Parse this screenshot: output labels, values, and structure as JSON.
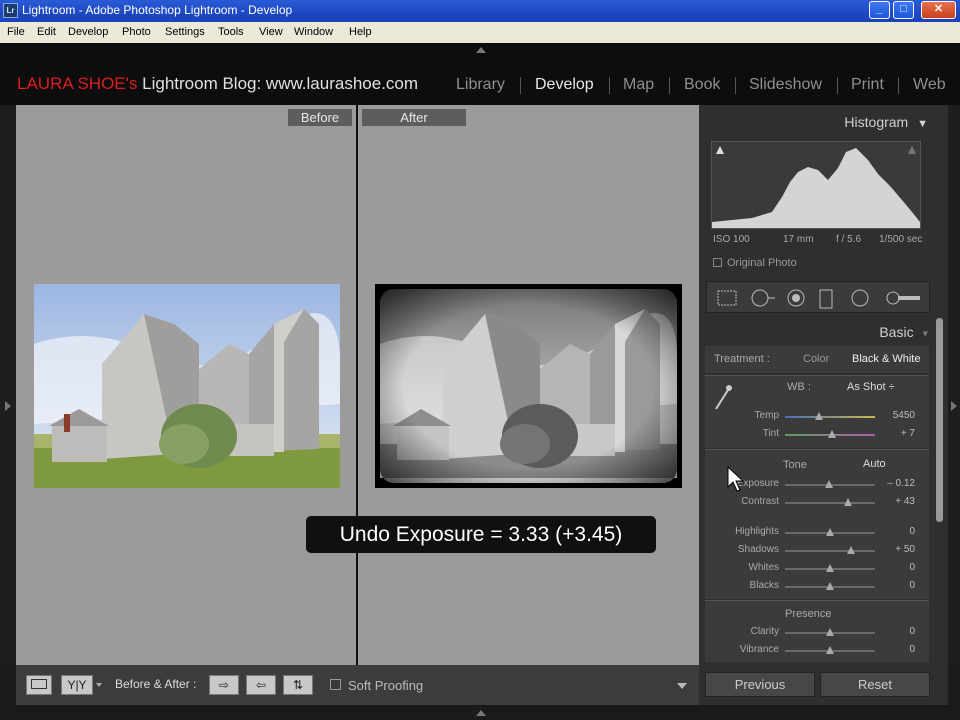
{
  "window": {
    "title": "Lightroom - Adobe Photoshop Lightroom - Develop",
    "icon": "Lr"
  },
  "menu": [
    "File",
    "Edit",
    "Develop",
    "Photo",
    "Settings",
    "Tools",
    "View",
    "Window",
    "Help"
  ],
  "header": {
    "brand_red": "LAURA SHOE's",
    "brand_rest": " Lightroom Blog: www.laurashoe.com",
    "modules": [
      "Library",
      "Develop",
      "Map",
      "Book",
      "Slideshow",
      "Print",
      "Web"
    ],
    "active_module": "Develop"
  },
  "viewer": {
    "before_label": "Before",
    "after_label": "After",
    "overlay": "Undo Exposure = 3.33 (+3.45)"
  },
  "toolbar": {
    "view_mode": "Y|Y",
    "before_after_label": "Before & After :",
    "soft_proofing": "Soft Proofing"
  },
  "panel": {
    "histogram_title": "Histogram",
    "histogram_info": {
      "iso": "ISO 100",
      "focal": "17 mm",
      "aperture": "f / 5.6",
      "shutter": "1/500 sec"
    },
    "original_photo": "Original Photo",
    "basic_title": "Basic",
    "treatment": {
      "label": "Treatment :",
      "color": "Color",
      "bw": "Black & White"
    },
    "wb": {
      "label": "WB :",
      "value": "As Shot ÷"
    },
    "wb_sliders": [
      {
        "name": "Temp",
        "value": "5450",
        "pos": 0.38
      },
      {
        "name": "Tint",
        "value": "+ 7",
        "pos": 0.52
      }
    ],
    "tone": {
      "label": "Tone",
      "auto": "Auto"
    },
    "tone_sliders": [
      {
        "name": "Exposure",
        "value": "– 0.12",
        "pos": 0.49
      },
      {
        "name": "Contrast",
        "value": "+ 43",
        "pos": 0.7
      }
    ],
    "tone_sliders2": [
      {
        "name": "Highlights",
        "value": "0",
        "pos": 0.5
      },
      {
        "name": "Shadows",
        "value": "+ 50",
        "pos": 0.73
      },
      {
        "name": "Whites",
        "value": "0",
        "pos": 0.5
      },
      {
        "name": "Blacks",
        "value": "0",
        "pos": 0.5
      }
    ],
    "presence": {
      "label": "Presence"
    },
    "presence_sliders": [
      {
        "name": "Clarity",
        "value": "0",
        "pos": 0.5
      },
      {
        "name": "Vibrance",
        "value": "0",
        "pos": 0.5
      }
    ],
    "previous": "Previous",
    "reset": "Reset"
  }
}
